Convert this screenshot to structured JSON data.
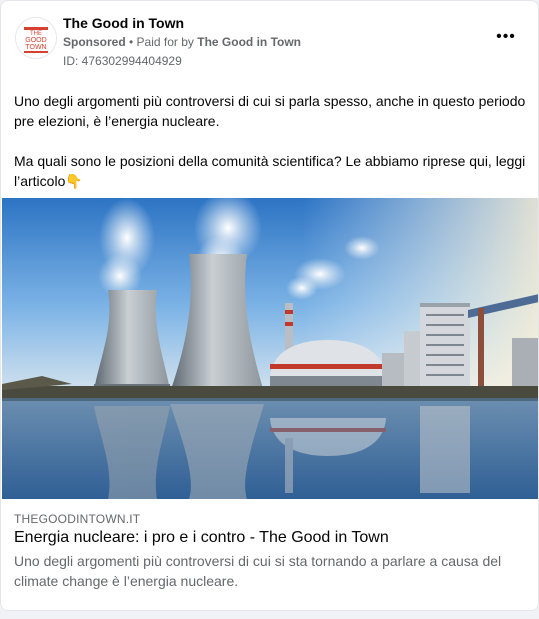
{
  "post": {
    "page_name": "The Good in Town",
    "sponsored": "Sponsored",
    "separator": " • ",
    "paid_for_prefix": "Paid for by ",
    "paid_for_name": "The Good in Town",
    "ad_id": "ID: 476302994404929",
    "logo_text_top": "THE",
    "logo_text_mid": "GOOD",
    "logo_text_bottom": "TOWN",
    "more_label": "•••",
    "paragraph1": "Uno degli argomenti più controversi di cui si parla spesso, anche in questo periodo pre elezioni, è l’energia nucleare.",
    "paragraph2": "Ma quali sono le posizioni della comunità scientifica? Le abbiamo riprese qui, leggi l’articolo👇",
    "image_icon": "nuclear-power-plant-photo"
  },
  "link": {
    "domain": "THEGOODINTOWN.IT",
    "title": "Energia nucleare: i pro e i contro - The Good in Town",
    "description": "Uno degli argomenti più controversi di cui si sta tornando a parlare a causa del climate change è l’energia nucleare."
  },
  "colors": {
    "brand_red": "#d8412f",
    "text_primary": "#050505",
    "text_secondary": "#65676b"
  }
}
